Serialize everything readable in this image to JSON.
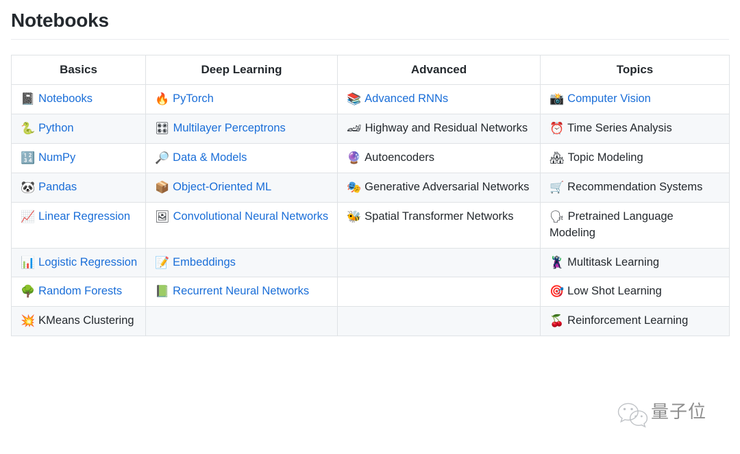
{
  "page": {
    "title": "Notebooks"
  },
  "table": {
    "headers": [
      {
        "label": "Basics"
      },
      {
        "label": "Deep Learning"
      },
      {
        "label": "Advanced"
      },
      {
        "label": "Topics"
      }
    ],
    "rows": [
      {
        "basics": {
          "icon": "📓",
          "icon_name": "notebook-icon",
          "text": "Notebooks",
          "link": true
        },
        "deep_learning": {
          "icon": "🔥",
          "icon_name": "fire-icon",
          "text": "PyTorch",
          "link": true
        },
        "advanced": {
          "icon": "📚",
          "icon_name": "books-icon",
          "text": "Advanced RNNs",
          "link": true
        },
        "topics": {
          "icon": "📸",
          "icon_name": "camera-flash-icon",
          "text": "Computer Vision",
          "link": true
        }
      },
      {
        "basics": {
          "icon": "🐍",
          "icon_name": "snake-icon",
          "text": "Python",
          "link": true
        },
        "deep_learning": {
          "icon": "🎛",
          "icon_name": "control-knobs-icon",
          "text": "Multilayer Perceptrons",
          "link": true
        },
        "advanced": {
          "icon": "🏎",
          "icon_name": "racing-car-icon",
          "text": "Highway and Residual Networks",
          "link": false
        },
        "topics": {
          "icon": "⏰",
          "icon_name": "alarm-clock-icon",
          "text": "Time Series Analysis",
          "link": false
        }
      },
      {
        "basics": {
          "icon": "🔢",
          "icon_name": "numbers-icon",
          "text": "NumPy",
          "link": true
        },
        "deep_learning": {
          "icon": "🔎",
          "icon_name": "magnifier-icon",
          "text": "Data & Models",
          "link": true
        },
        "advanced": {
          "icon": "🔮",
          "icon_name": "crystal-ball-icon",
          "text": "Autoencoders",
          "link": false
        },
        "topics": {
          "icon": "🏘",
          "icon_name": "houses-icon",
          "text": "Topic Modeling",
          "link": false
        }
      },
      {
        "basics": {
          "icon": "🐼",
          "icon_name": "panda-icon",
          "text": "Pandas",
          "link": true
        },
        "deep_learning": {
          "icon": "📦",
          "icon_name": "package-icon",
          "text": "Object-Oriented ML",
          "link": true
        },
        "advanced": {
          "icon": "🎭",
          "icon_name": "masks-icon",
          "text": "Generative Adversarial Networks",
          "link": false
        },
        "topics": {
          "icon": "🛒",
          "icon_name": "shopping-cart-icon",
          "text": "Recommendation Systems",
          "link": false
        }
      },
      {
        "basics": {
          "icon": "📈",
          "icon_name": "chart-up-icon",
          "text": "Linear Regression",
          "link": true
        },
        "deep_learning": {
          "icon": "🖼",
          "icon_name": "framed-picture-icon",
          "text": "Convolutional Neural Networks",
          "link": true
        },
        "advanced": {
          "icon": "🐝",
          "icon_name": "bee-icon",
          "text": "Spatial Transformer Networks",
          "link": false
        },
        "topics": {
          "icon": "🗣",
          "icon_name": "speaking-head-icon",
          "text": "Pretrained Language Modeling",
          "link": false
        }
      },
      {
        "basics": {
          "icon": "📊",
          "icon_name": "bar-chart-icon",
          "text": "Logistic Regression",
          "link": true
        },
        "deep_learning": {
          "icon": "📝",
          "icon_name": "memo-icon",
          "text": "Embeddings",
          "link": true
        },
        "advanced": {
          "icon": "",
          "icon_name": "",
          "text": "",
          "link": false
        },
        "topics": {
          "icon": "🦹",
          "icon_name": "supervillain-icon",
          "text": "Multitask Learning",
          "link": false
        }
      },
      {
        "basics": {
          "icon": "🌳",
          "icon_name": "tree-icon",
          "text": "Random Forests",
          "link": true
        },
        "deep_learning": {
          "icon": "📗",
          "icon_name": "green-book-icon",
          "text": "Recurrent Neural Networks",
          "link": true
        },
        "advanced": {
          "icon": "",
          "icon_name": "",
          "text": "",
          "link": false
        },
        "topics": {
          "icon": "🎯",
          "icon_name": "target-icon",
          "text": "Low Shot Learning",
          "link": false
        }
      },
      {
        "basics": {
          "icon": "💥",
          "icon_name": "collision-icon",
          "text": "KMeans Clustering",
          "link": false
        },
        "deep_learning": {
          "icon": "",
          "icon_name": "",
          "text": "",
          "link": false
        },
        "advanced": {
          "icon": "",
          "icon_name": "",
          "text": "",
          "link": false
        },
        "topics": {
          "icon": "🍒",
          "icon_name": "cherries-icon",
          "text": "Reinforcement Learning",
          "link": false
        }
      }
    ]
  },
  "watermark": {
    "text": "量子位",
    "logo_name": "wechat-logo"
  },
  "colors": {
    "link": "#1a6ed8",
    "text": "#24292e",
    "border": "#dfe2e5",
    "stripe": "#f6f8fa"
  }
}
